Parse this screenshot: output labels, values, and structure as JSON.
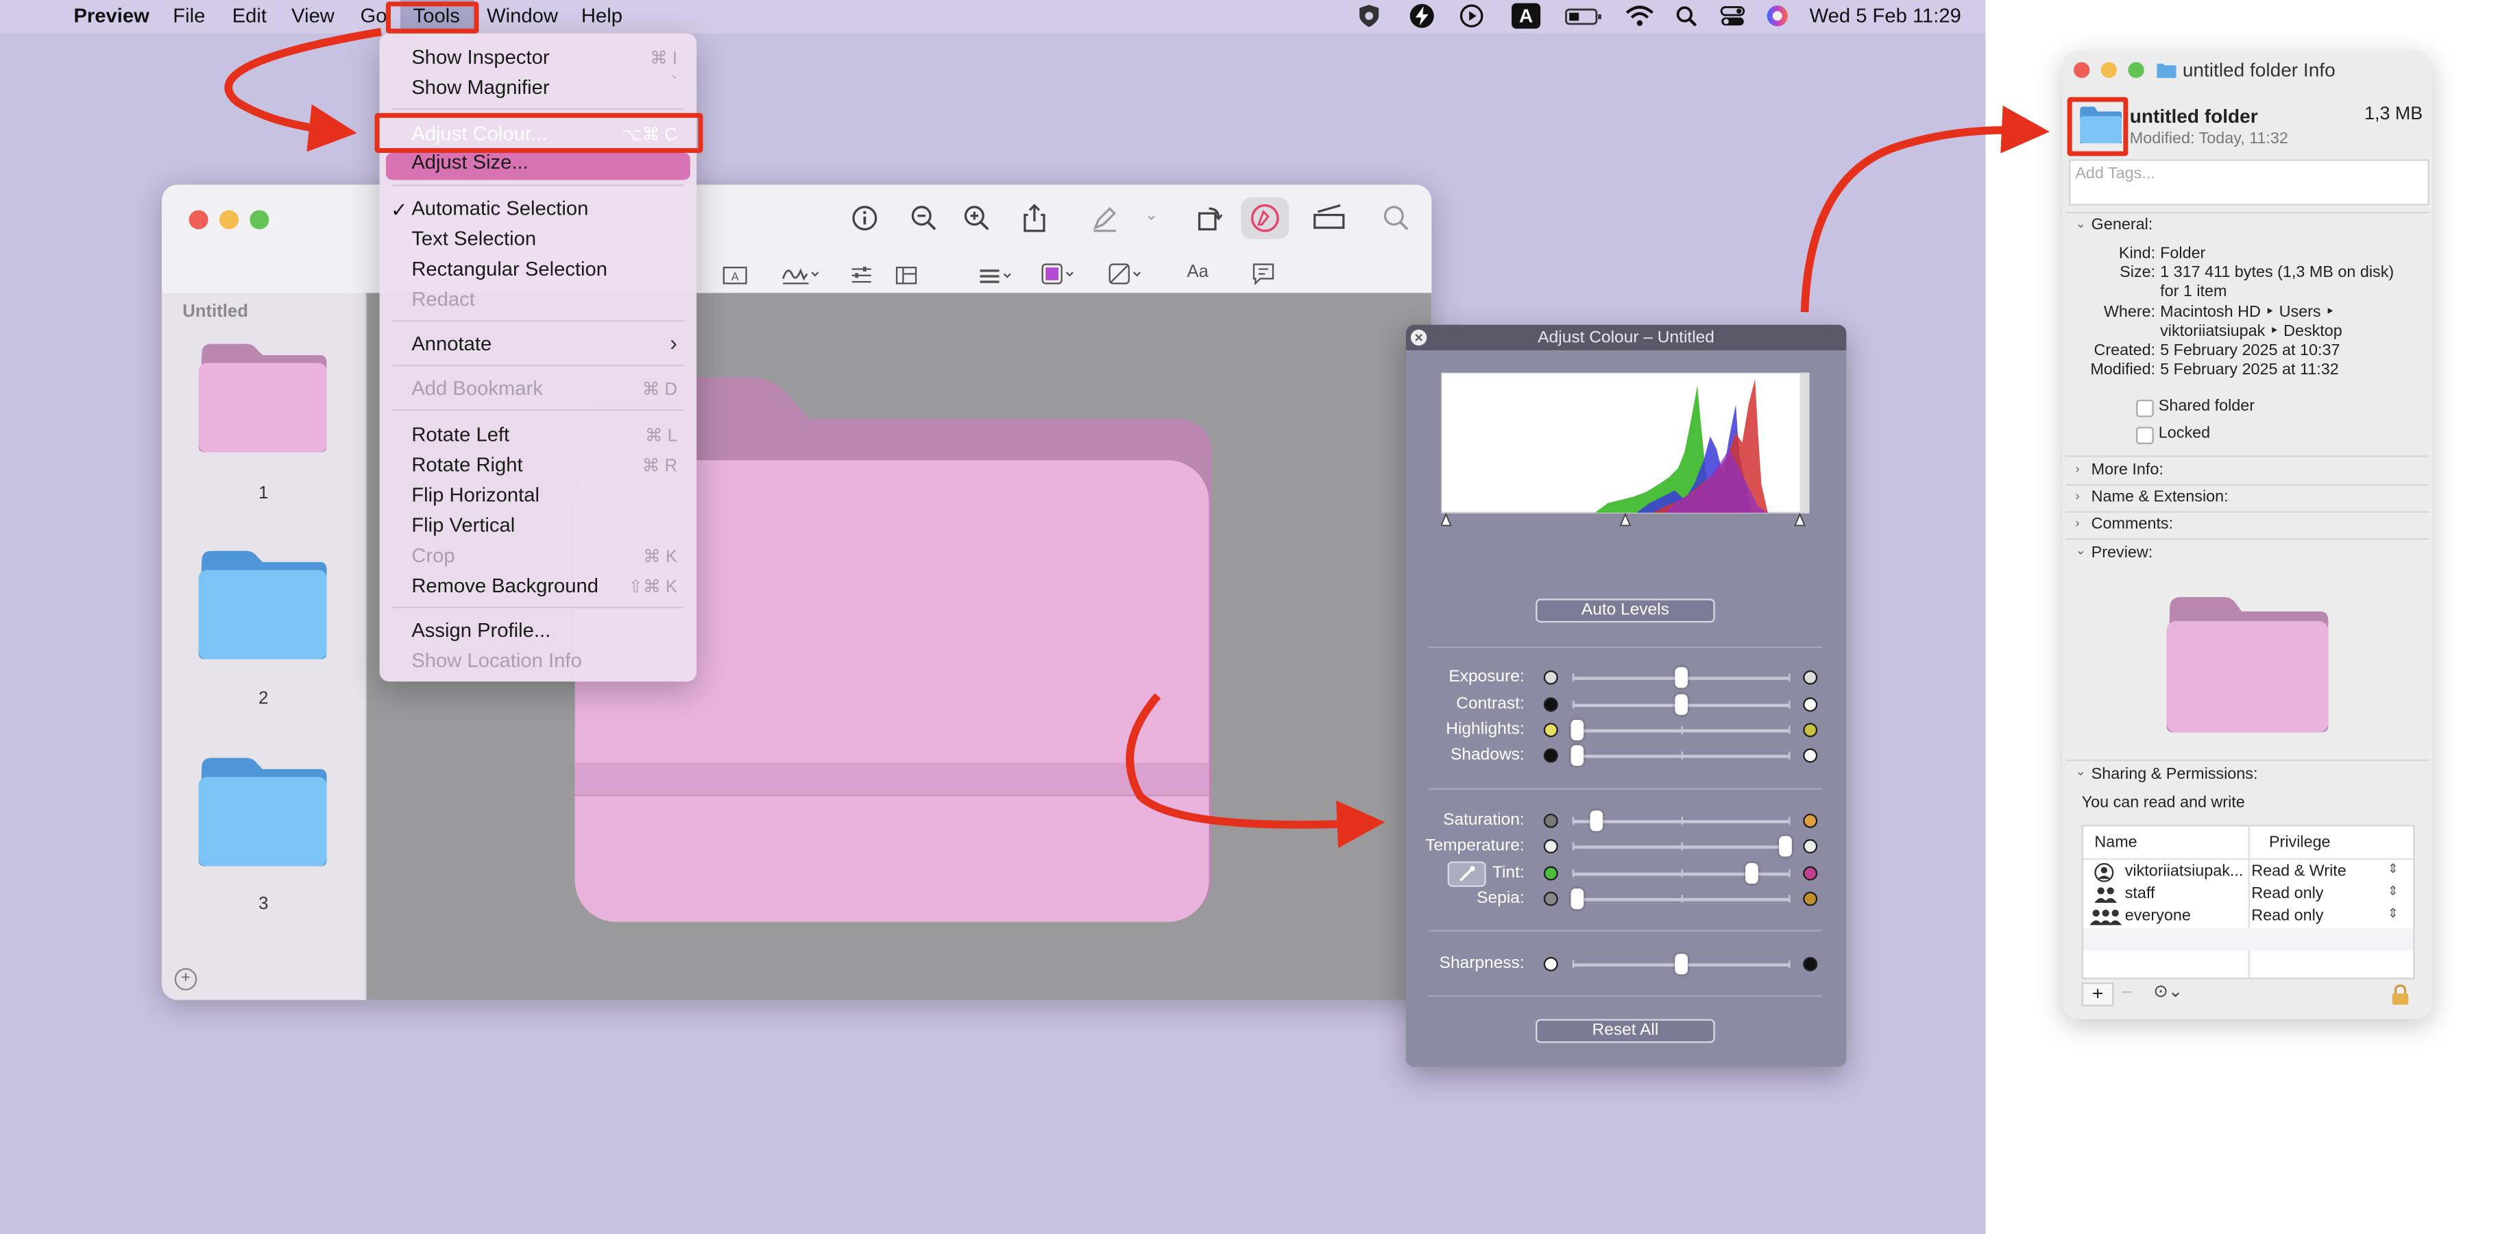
{
  "menubar": {
    "app_name": "Preview",
    "items": [
      "File",
      "Edit",
      "View",
      "Go",
      "Tools",
      "Window",
      "Help"
    ],
    "clock": "Wed 5 Feb  11:29",
    "status_icons": [
      "shield-icon",
      "bolt-icon",
      "play-icon",
      "input-source-icon",
      "battery-icon",
      "wifi-icon",
      "spotlight-icon",
      "control-center-icon",
      "siri-icon"
    ],
    "input_source_label": "A"
  },
  "tools_menu": {
    "items": [
      {
        "label": "Show Inspector",
        "shortcut": "⌘ I",
        "enabled": true
      },
      {
        "label": "Show Magnifier",
        "shortcut": "`",
        "enabled": true
      },
      {
        "label": "Adjust Colour...",
        "shortcut": "⌥⌘ C",
        "enabled": true,
        "highlighted": true
      },
      {
        "label": "Adjust Size...",
        "shortcut": "",
        "enabled": true
      },
      {
        "label": "Automatic Selection",
        "shortcut": "",
        "enabled": true,
        "checked": true
      },
      {
        "label": "Text Selection",
        "shortcut": "",
        "enabled": true
      },
      {
        "label": "Rectangular Selection",
        "shortcut": "",
        "enabled": true
      },
      {
        "label": "Redact",
        "shortcut": "",
        "enabled": false
      },
      {
        "label": "Annotate",
        "shortcut": "›",
        "enabled": true
      },
      {
        "label": "Add Bookmark",
        "shortcut": "⌘ D",
        "enabled": false
      },
      {
        "label": "Rotate Left",
        "shortcut": "⌘ L",
        "enabled": true
      },
      {
        "label": "Rotate Right",
        "shortcut": "⌘ R",
        "enabled": true
      },
      {
        "label": "Flip Horizontal",
        "shortcut": "",
        "enabled": true
      },
      {
        "label": "Flip Vertical",
        "shortcut": "",
        "enabled": true
      },
      {
        "label": "Crop",
        "shortcut": "⌘ K",
        "enabled": false
      },
      {
        "label": "Remove Background",
        "shortcut": "⇧⌘ K",
        "enabled": true
      },
      {
        "label": "Assign Profile...",
        "shortcut": "",
        "enabled": true
      },
      {
        "label": "Show Location Info",
        "shortcut": "",
        "enabled": false
      }
    ]
  },
  "preview_window": {
    "sidebar_title": "Untitled",
    "thumbnails": [
      {
        "label": "1",
        "color": "#e9b3de"
      },
      {
        "label": "2",
        "color": "#7cc4f5"
      },
      {
        "label": "3",
        "color": "#7cc4f5"
      }
    ],
    "toolbar_icons": [
      "info-icon",
      "zoom-out-icon",
      "zoom-in-icon",
      "share-icon",
      "highlight-icon",
      "rotate-icon",
      "markup-icon",
      "sign-icon",
      "search-icon"
    ],
    "markup_icons": [
      "text-box-icon",
      "signature-icon",
      "adjust-icon",
      "page-layout-icon",
      "line-style-icon",
      "border-color-icon",
      "fill-color-icon",
      "font-icon",
      "note-icon"
    ],
    "font_label": "Aa"
  },
  "adjust_panel": {
    "title": "Adjust Colour – Untitled",
    "auto_levels": "Auto Levels",
    "reset_all": "Reset All",
    "sliders": [
      {
        "label": "Exposure:",
        "value": 0.5
      },
      {
        "label": "Contrast:",
        "value": 0.5
      },
      {
        "label": "Highlights:",
        "value": 0.02
      },
      {
        "label": "Shadows:",
        "value": 0.02
      },
      {
        "label": "Saturation:",
        "value": 0.11
      },
      {
        "label": "Temperature:",
        "value": 0.98
      },
      {
        "label": "Tint:",
        "value": 0.82
      },
      {
        "label": "Sepia:",
        "value": 0.02
      },
      {
        "label": "Sharpness:",
        "value": 0.5
      }
    ]
  },
  "info_window": {
    "title": "untitled folder Info",
    "name": "untitled folder",
    "size": "1,3 MB",
    "modified_line": "Modified: Today, 11:32",
    "tags_placeholder": "Add Tags...",
    "general": "General:",
    "kind_key": "Kind:",
    "kind": "Folder",
    "size_key": "Size:",
    "size_line1": "1 317 411 bytes (1,3 MB on disk)",
    "size_line2": "for 1 item",
    "where_key": "Where:",
    "where_line1": "Macintosh HD ‣ Users ‣",
    "where_line2": "viktoriiatsiupak ‣ Desktop",
    "created_key": "Created:",
    "created": "5 February 2025 at 10:37",
    "modified_key": "Modified:",
    "modified": "5 February 2025 at 11:32",
    "shared_folder": "Shared folder",
    "locked": "Locked",
    "more_info": "More Info:",
    "name_ext": "Name & Extension:",
    "comments": "Comments:",
    "preview": "Preview:",
    "sharing": "Sharing & Permissions:",
    "sharing_note": "You can read and write",
    "col_name": "Name",
    "col_privilege": "Privilege",
    "permissions": [
      {
        "name": "viktoriiatsiupak...",
        "privilege": "Read & Write"
      },
      {
        "name": "staff",
        "privilege": "Read only"
      },
      {
        "name": "everyone",
        "privilege": "Read only"
      }
    ]
  },
  "colors": {
    "pink_folder": "#e9b3de",
    "blue_folder": "#7cc4f5",
    "annotation_red": "#e5301b",
    "menu_highlight": "#d873b3"
  }
}
